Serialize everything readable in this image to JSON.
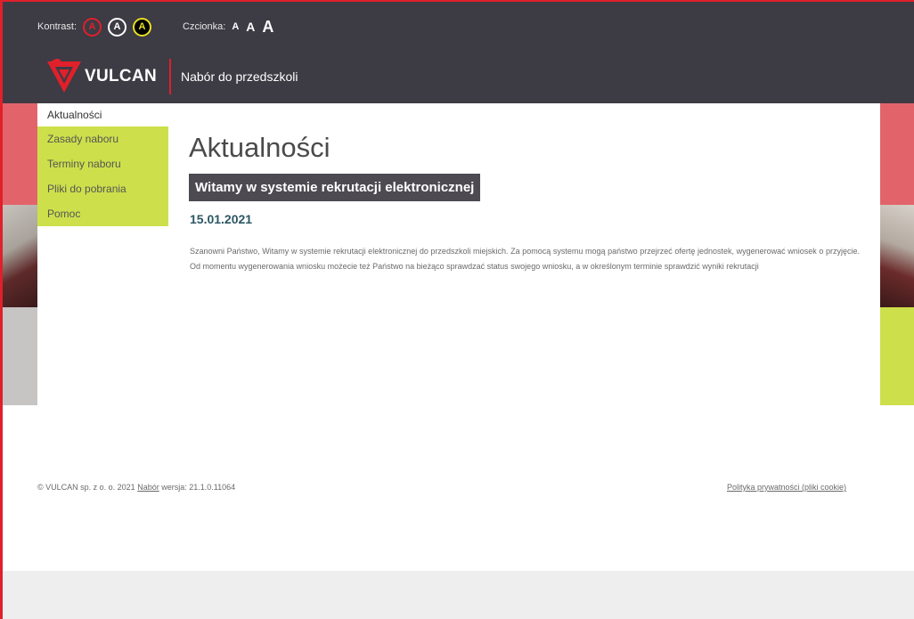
{
  "header": {
    "contrast_label": "Kontrast:",
    "contrast_options": [
      "A",
      "A",
      "A"
    ],
    "font_label": "Czcionka:",
    "font_sizes": [
      "A",
      "A",
      "A"
    ],
    "logo_text": "VULCAN",
    "app_title": "Nabór do przedszkoli"
  },
  "nav": {
    "items": [
      "Aktualności",
      "Zasady naboru",
      "Terminy naboru",
      "Pliki do pobrania",
      "Pomoc"
    ]
  },
  "main": {
    "title": "Aktualności",
    "post": {
      "title": "Witamy w systemie rekrutacji elektronicznej",
      "date": "15.01.2021",
      "body": "Szanowni Państwo, Witamy w systemie rekrutacji elektronicznej do przedszkoli miejskich. Za pomocą systemu mogą państwo przejrzeć ofertę jednostek, wygenerować wniosek o przyjęcie. Od momentu wygenerowania wniosku możecie też Państwo na bieżąco sprawdzać status swojego wniosku, a w określonym terminie sprawdzić wyniki rekrutacji"
    }
  },
  "footer": {
    "copyright": "© VULCAN sp. z o. o. 2021",
    "nabor_link": "Nabór",
    "version": "wersja: 21.1.0.11064",
    "privacy_link": "Polityka prywatności (pliki cookie)"
  },
  "colors": {
    "header_bg": "#3d3b44",
    "brand_red": "#e0202a",
    "accent_lime": "#cde04b",
    "date_teal": "#2c5763",
    "post_title_bg": "#4d4a52"
  }
}
